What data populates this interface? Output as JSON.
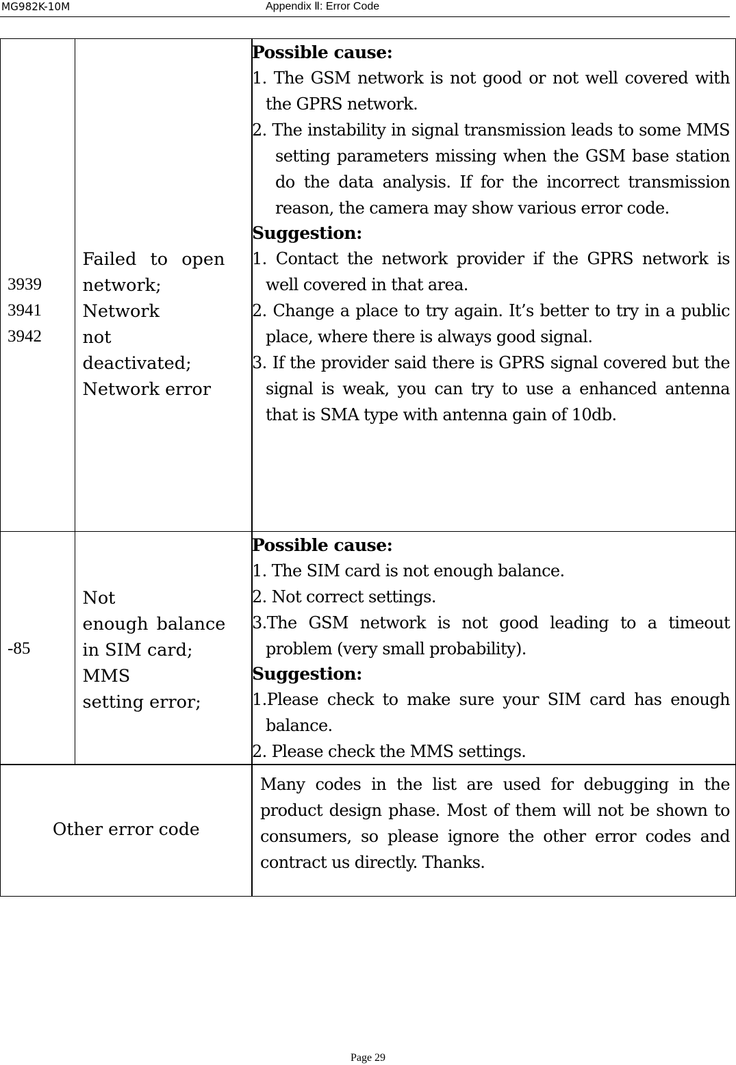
{
  "header": {
    "model": "MG982K-10M",
    "section": "Appendix Ⅱ: Error Code"
  },
  "table": {
    "rows": [
      {
        "codes": [
          "3939",
          "3941",
          "3942"
        ],
        "description_lines": [
          "Failed to open",
          "network;",
          "Network",
          "not",
          "deactivated;",
          "Network error"
        ],
        "possible_cause_title": "Possible cause:",
        "possible_causes": [
          "1. The GSM network is not good or not well covered with the GPRS network.",
          "2. The instability in signal transmission leads to some MMS setting parameters missing when the GSM base station do the data analysis. If for the incorrect transmission reason, the camera may show various error code."
        ],
        "suggestion_title": "Suggestion:",
        "suggestions": [
          "1. Contact the network provider if the GPRS network is well covered in that area.",
          "2. Change a place to try again. It’s better to try in a public place, where there is always good signal.",
          "3. If the provider said there is GPRS signal covered but the signal is weak, you can try to use a enhanced antenna that is SMA type with antenna gain of 10db."
        ]
      },
      {
        "codes": [
          "-85"
        ],
        "description_lines": [
          "Not",
          "enough balance",
          "in SIM card;",
          "MMS",
          "setting error;"
        ],
        "possible_cause_title": "Possible cause:",
        "possible_causes": [
          "1. The SIM card is not enough balance.",
          "2. Not correct settings.",
          "3.The GSM network is not good leading to a timeout problem (very small probability)."
        ],
        "suggestion_title": "Suggestion:",
        "suggestions": [
          "1.Please check to make sure your SIM card has enough balance.",
          "2. Please check the MMS settings."
        ]
      },
      {
        "label": "Other error code",
        "note": "Many codes in the list are used for debugging in the product design phase. Most of them will not be shown to consumers, so please ignore the other error codes and contract us directly. Thanks."
      }
    ]
  },
  "footer": {
    "page": "Page 29"
  }
}
